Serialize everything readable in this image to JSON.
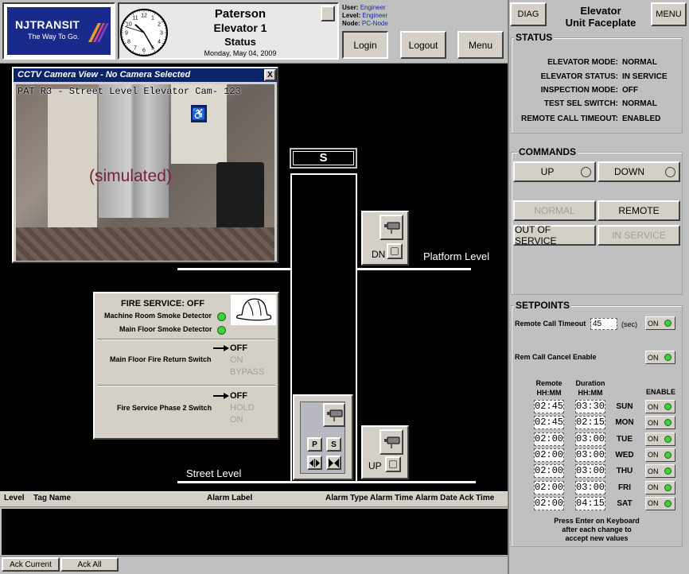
{
  "header": {
    "logo_text": "NJTRANSIT",
    "logo_tagline": "The Way To Go.",
    "station": "Paterson",
    "elevator": "Elevator 1",
    "view": "Status",
    "date": "Monday, May 04, 2009",
    "clock": {
      "hour": 10,
      "minute": 25,
      "second": 48
    },
    "user_label": "User:",
    "user_value": "Engineer",
    "level_label": "Level:",
    "level_value": "Engineer",
    "node_label": "Node:",
    "node_value": "PC-Node",
    "login": "Login",
    "logout": "Logout",
    "menu": "Menu"
  },
  "cctv": {
    "title": "CCTV Camera View - No Camera Selected",
    "close": "X",
    "overlay": "PAT R3 - Street Level Elevator Cam- 123",
    "simulated": "(simulated)"
  },
  "shaft": {
    "car_label": "S",
    "platform_level": "Platform Level",
    "street_level": "Street Level",
    "dn": "DN",
    "up": "UP",
    "p": "P",
    "s": "S"
  },
  "fire": {
    "status": "FIRE SERVICE: OFF",
    "machine_room": "Machine Room Smoke Detector",
    "main_floor": "Main Floor Smoke Detector",
    "return_label": "Main Floor Fire Return Switch",
    "return_opts": [
      "OFF",
      "ON",
      "BYPASS"
    ],
    "phase2_label": "Fire Service Phase 2 Switch",
    "phase2_opts": [
      "OFF",
      "HOLD",
      "ON"
    ]
  },
  "alarms": {
    "columns": [
      "Level",
      "Tag Name",
      "Alarm Label",
      "Alarm Type",
      "Alarm Time",
      "Alarm Date",
      "Ack Time"
    ],
    "ack_current": "Ack Current",
    "ack_all": "Ack All"
  },
  "panel": {
    "diag": "DIAG",
    "title1": "Elevator",
    "title2": "Unit Faceplate",
    "menu": "MENU",
    "status_title": "STATUS",
    "status_rows": [
      {
        "k": "ELEVATOR MODE:",
        "v": "NORMAL"
      },
      {
        "k": "ELEVATOR STATUS:",
        "v": "IN SERVICE"
      },
      {
        "k": "INSPECTION MODE:",
        "v": "OFF"
      },
      {
        "k": "TEST SEL SWITCH:",
        "v": "NORMAL"
      },
      {
        "k": "REMOTE CALL TIMEOUT:",
        "v": "ENABLED"
      }
    ],
    "commands_title": "COMMANDS",
    "up": "UP",
    "down": "DOWN",
    "normal": "NORMAL",
    "remote": "REMOTE",
    "out_of_service": "OUT OF SERVICE",
    "in_service": "IN SERVICE",
    "setpoints_title": "SETPOINTS",
    "rct_label": "Remote Call Timeout",
    "rct_value": "45",
    "rct_unit": "(sec)",
    "on": "ON",
    "rcce_label": "Rem Call Cancel Enable",
    "col_remote": "Remote",
    "col_duration": "Duration",
    "col_hhmm": "HH:MM",
    "col_enable": "ENABLE",
    "schedule": [
      {
        "day": "SUN",
        "remote": "02:45",
        "duration": "03:30"
      },
      {
        "day": "MON",
        "remote": "02:45",
        "duration": "02:15"
      },
      {
        "day": "TUE",
        "remote": "02:00",
        "duration": "03:00"
      },
      {
        "day": "WED",
        "remote": "02:00",
        "duration": "03:00"
      },
      {
        "day": "THU",
        "remote": "02:00",
        "duration": "03:00"
      },
      {
        "day": "FRI",
        "remote": "02:00",
        "duration": "03:00"
      },
      {
        "day": "SAT",
        "remote": "02:00",
        "duration": "04:15"
      }
    ],
    "note1": "Press Enter on Keyboard",
    "note2": "after each change to",
    "note3": "accept new values"
  }
}
